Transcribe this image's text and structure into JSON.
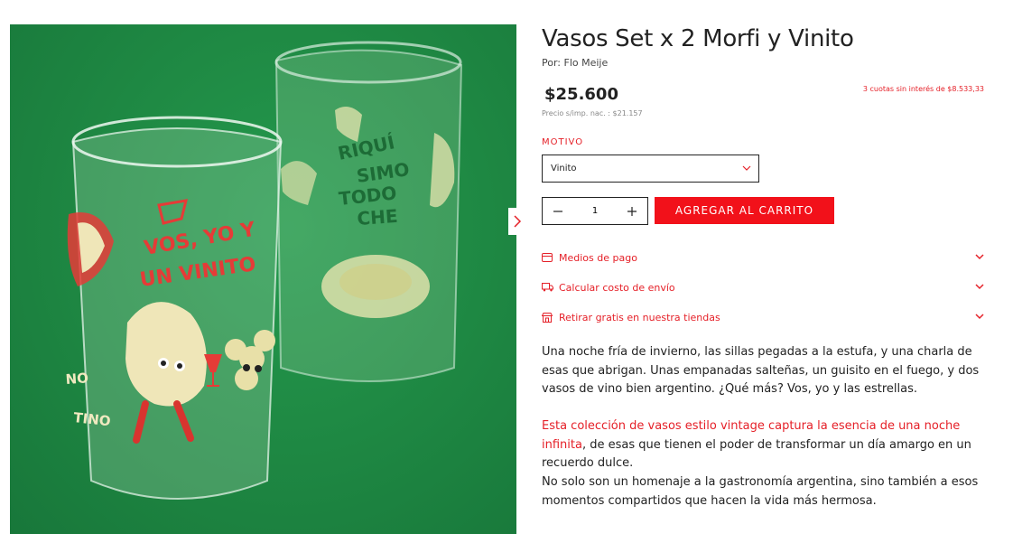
{
  "product": {
    "title": "Vasos Set x 2 Morfi y Vinito",
    "brand": "Por: Flo Meije",
    "price": "$25.600",
    "installments": "3 cuotas sin interés de $8.533,33",
    "tax_price": "Precio s/imp. nac. : $21.157"
  },
  "image": {
    "glass_front_text_1": "VOS, YO Y",
    "glass_front_text_2": "UN VINITO",
    "glass_front_text_3": "NO",
    "glass_front_text_4": "TINO",
    "glass_back_text_1": "RIQUÍ",
    "glass_back_text_2": "SIMO",
    "glass_back_text_3": "TODO",
    "glass_back_text_4": "CHE"
  },
  "option": {
    "label": "MOTIVO",
    "selected": "Vinito"
  },
  "quantity": {
    "value": "1"
  },
  "cart": {
    "button_label": "AGREGAR AL CARRITO"
  },
  "accordion": [
    {
      "label": "Medios de pago",
      "icon": "credit-card-icon"
    },
    {
      "label": "Calcular costo de envío",
      "icon": "truck-icon"
    },
    {
      "label": "Retirar gratis en nuestra tiendas",
      "icon": "store-icon"
    }
  ],
  "description": {
    "p1": "Una noche fría de invierno, las sillas pegadas a la estufa, y una charla de esas que abrigan. Unas empanadas salteñas, un guisito en el fuego, y dos vasos de vino bien argentino. ¿Qué más? Vos, yo y las estrellas.",
    "p2_highlight": "Esta colección de vasos estilo vintage captura la esencia de una noche infinita",
    "p2_rest": ", de esas que tienen el poder de transformar un día amargo en un recuerdo dulce.",
    "p3": "No solo son un homenaje a la gastronomía argentina, sino también a esos momentos compartidos que hacen la vida más hermosa."
  },
  "colors": {
    "accent": "#e52028",
    "button": "#f2111a",
    "background_green": "#1f8a44"
  }
}
